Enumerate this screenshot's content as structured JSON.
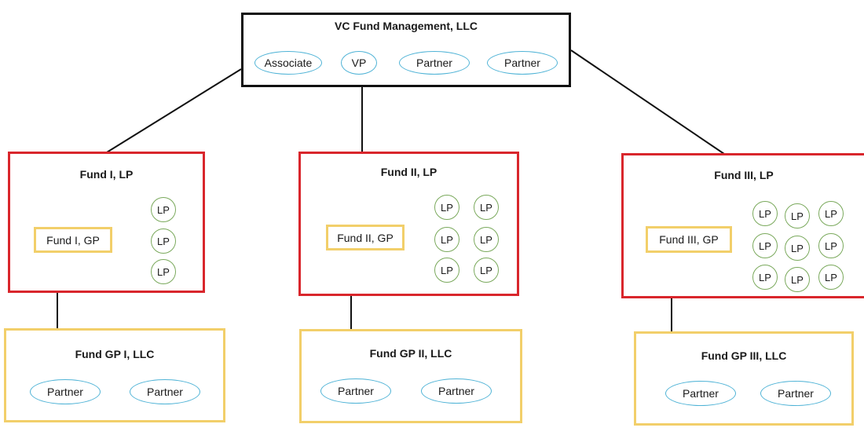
{
  "diagram": {
    "management": {
      "title": "VC Fund Management, LLC",
      "members": [
        "Associate",
        "VP",
        "Partner",
        "Partner"
      ]
    },
    "funds": [
      {
        "title": "Fund I, LP",
        "gp": "Fund I, GP",
        "lp_label": "LP",
        "lp_count": 3,
        "gp_llc": {
          "title": "Fund GP I, LLC",
          "members": [
            "Partner",
            "Partner"
          ]
        }
      },
      {
        "title": "Fund II, LP",
        "gp": "Fund II, GP",
        "lp_label": "LP",
        "lp_count": 6,
        "gp_llc": {
          "title": "Fund GP II, LLC",
          "members": [
            "Partner",
            "Partner"
          ]
        }
      },
      {
        "title": "Fund III, LP",
        "gp": "Fund III, GP",
        "lp_label": "LP",
        "lp_count": 9,
        "gp_llc": {
          "title": "Fund GP III, LLC",
          "members": [
            "Partner",
            "Partner"
          ]
        }
      }
    ],
    "colors": {
      "management_border": "#111111",
      "fund_border": "#d9262c",
      "gp_border": "#f2cf6a",
      "member_oval": "#4fb3d6",
      "lp_circle": "#7aa95c",
      "connector": "#111111"
    }
  }
}
